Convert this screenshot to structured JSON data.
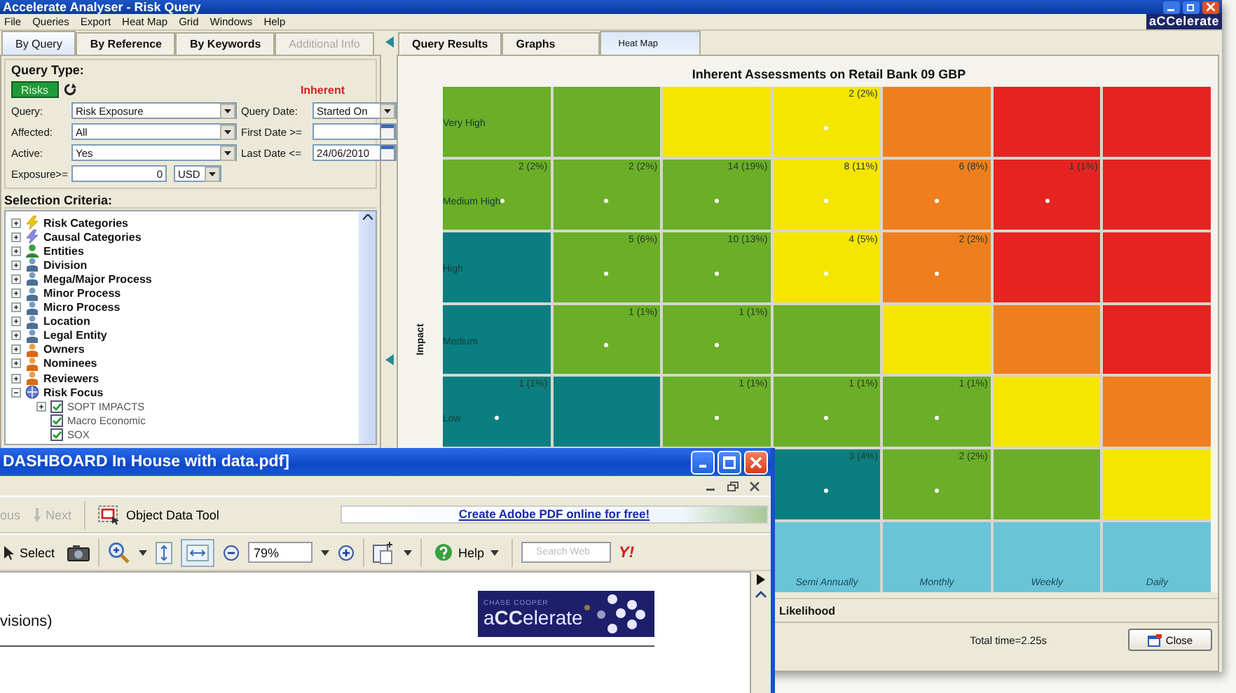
{
  "window": {
    "title": "Accelerate Analyser - Risk Query",
    "logo": "aCCelerate"
  },
  "menu": [
    "File",
    "Queries",
    "Export",
    "Heat Map",
    "Grid",
    "Windows",
    "Help"
  ],
  "query_panel": {
    "tabs": [
      {
        "label": "By Query",
        "selected": true,
        "disabled": false
      },
      {
        "label": "By Reference",
        "selected": false,
        "disabled": false
      },
      {
        "label": "By Keywords",
        "selected": false,
        "disabled": false
      },
      {
        "label": "Additional Info",
        "selected": false,
        "disabled": true
      }
    ],
    "query_type": {
      "heading": "Query Type:",
      "button": "Risks",
      "mode": "Inherent"
    },
    "fields": [
      {
        "label": "Query:",
        "value": "Risk Exposure",
        "kind": "dropdown"
      },
      {
        "label": "Query Date:",
        "value": "Started On",
        "kind": "dropdown"
      },
      {
        "label": "Affected:",
        "value": "All",
        "kind": "dropdown"
      },
      {
        "label": "First Date >=",
        "kind": "date"
      },
      {
        "label": "Active:",
        "value": "Yes",
        "kind": "dropdown"
      },
      {
        "label": "Last Date <=",
        "value": "24/06/2010",
        "kind": "date"
      },
      {
        "label": "Exposure>=",
        "value": "0",
        "kind": "number",
        "unit": "USD"
      }
    ],
    "selection": {
      "heading": "Selection Criteria:",
      "tree": [
        {
          "label": "Risk Categories",
          "kind": "risk",
          "expanded": false
        },
        {
          "label": "Causal Categories",
          "kind": "cause",
          "expanded": false
        },
        {
          "label": "Entities",
          "kind": "group",
          "expanded": false
        },
        {
          "label": "Division",
          "kind": "structure",
          "expanded": false
        },
        {
          "label": "Mega/Major Process",
          "kind": "structure",
          "expanded": false
        },
        {
          "label": "Minor Process",
          "kind": "structure",
          "expanded": false
        },
        {
          "label": "Micro Process",
          "kind": "structure",
          "expanded": false
        },
        {
          "label": "Location",
          "kind": "structure",
          "expanded": false
        },
        {
          "label": "Legal Entity",
          "kind": "structure",
          "expanded": false
        },
        {
          "label": "Owners",
          "kind": "person",
          "expanded": false
        },
        {
          "label": "Nominees",
          "kind": "person",
          "expanded": false
        },
        {
          "label": "Reviewers",
          "kind": "person",
          "expanded": false
        },
        {
          "label": "Risk Focus",
          "kind": "focus",
          "expanded": true,
          "children": [
            {
              "label": "SOPT IMPACTS",
              "checked": true,
              "expanded": false
            },
            {
              "label": "Macro Economic",
              "checked": true
            },
            {
              "label": "SOX",
              "checked": true
            }
          ]
        }
      ]
    }
  },
  "results": {
    "tabs": [
      {
        "label": "Query Results",
        "selected": false
      },
      {
        "label": "Graphs",
        "selected": false
      },
      {
        "label": "Heat Map",
        "selected": true
      }
    ],
    "heat_map": {
      "title": "Inherent Assessments on Retail Bank 09 GBP",
      "y_axis": "Impact",
      "x_axis": "Likelihood",
      "rows": [
        {
          "label": "Very High",
          "cells": [
            {
              "color": "#6aaf27"
            },
            {
              "color": "#6aaf27"
            },
            {
              "color": "#f5e600"
            },
            {
              "color": "#f5e600",
              "count": "2 (2%)"
            },
            {
              "color": "#ef7f1e"
            },
            {
              "color": "#e52421"
            },
            {
              "color": "#e52421"
            }
          ]
        },
        {
          "label": "Medium High",
          "cells": [
            {
              "color": "#6aaf27",
              "count": "2 (2%)"
            },
            {
              "color": "#6aaf27",
              "count": "2 (2%)"
            },
            {
              "color": "#6aaf27",
              "count": "14 (19%)"
            },
            {
              "color": "#f5e600",
              "count": "8 (11%)"
            },
            {
              "color": "#ef7f1e",
              "count": "6 (8%)"
            },
            {
              "color": "#e52421",
              "count": "1 (1%)"
            },
            {
              "color": "#e52421"
            }
          ]
        },
        {
          "label": "High",
          "cells": [
            {
              "color": "#0b7f80"
            },
            {
              "color": "#6aaf27",
              "count": "5 (6%)"
            },
            {
              "color": "#6aaf27",
              "count": "10 (13%)"
            },
            {
              "color": "#f5e600",
              "count": "4 (5%)"
            },
            {
              "color": "#ef7f1e",
              "count": "2 (2%)"
            },
            {
              "color": "#e52421"
            },
            {
              "color": "#e52421"
            }
          ]
        },
        {
          "label": "Medium",
          "cells": [
            {
              "color": "#0b7f80"
            },
            {
              "color": "#6aaf27",
              "count": "1 (1%)"
            },
            {
              "color": "#6aaf27",
              "count": "1 (1%)"
            },
            {
              "color": "#6aaf27"
            },
            {
              "color": "#f5e600"
            },
            {
              "color": "#ef7f1e"
            },
            {
              "color": "#e52421"
            }
          ]
        },
        {
          "label": "Low",
          "cells": [
            {
              "color": "#0b7f80",
              "count": "1 (1%)"
            },
            {
              "color": "#0b7f80"
            },
            {
              "color": "#6aaf27",
              "count": "1 (1%)"
            },
            {
              "color": "#6aaf27",
              "count": "1 (1%)"
            },
            {
              "color": "#6aaf27",
              "count": "1 (1%)"
            },
            {
              "color": "#f5e600"
            },
            {
              "color": "#ef7f1e"
            }
          ]
        },
        {
          "cells": [
            "",
            "",
            "",
            {
              "color": "#0b7f80",
              "count": "3 (4%)"
            },
            {
              "color": "#6aaf27",
              "count": "2 (2%)"
            },
            {
              "color": "#6aaf27"
            },
            {
              "color": "#f5e600"
            }
          ]
        },
        {
          "cells": [
            "",
            "",
            "",
            {
              "color": "#6ac4d8",
              "column_label": "Semi Annually"
            },
            {
              "color": "#6ac4d8",
              "column_label": "Monthly"
            },
            {
              "color": "#6ac4d8",
              "column_label": "Weekly"
            },
            {
              "color": "#6ac4d8",
              "column_label": "Daily"
            }
          ]
        }
      ]
    },
    "status": "Total time=2.25s",
    "close_button": "Close"
  },
  "pdf_window": {
    "title": "DASHBOARD In House with data.pdf]",
    "nav": [
      {
        "label": "ous",
        "disabled": true
      },
      {
        "label": "Next",
        "disabled": true
      }
    ],
    "tool": "Object Data Tool",
    "promo_link": "Create Adobe PDF online for free!",
    "select_tool": "Select",
    "zoom": "79%",
    "fit_width_pressed": true,
    "help": "Help",
    "search": {
      "placeholder": "Search Web"
    },
    "search_brand": "Y!",
    "document": {
      "text": "visions)",
      "logo_tagline": "CHASE COOPER",
      "logo": "a**CC**elerate"
    }
  }
}
